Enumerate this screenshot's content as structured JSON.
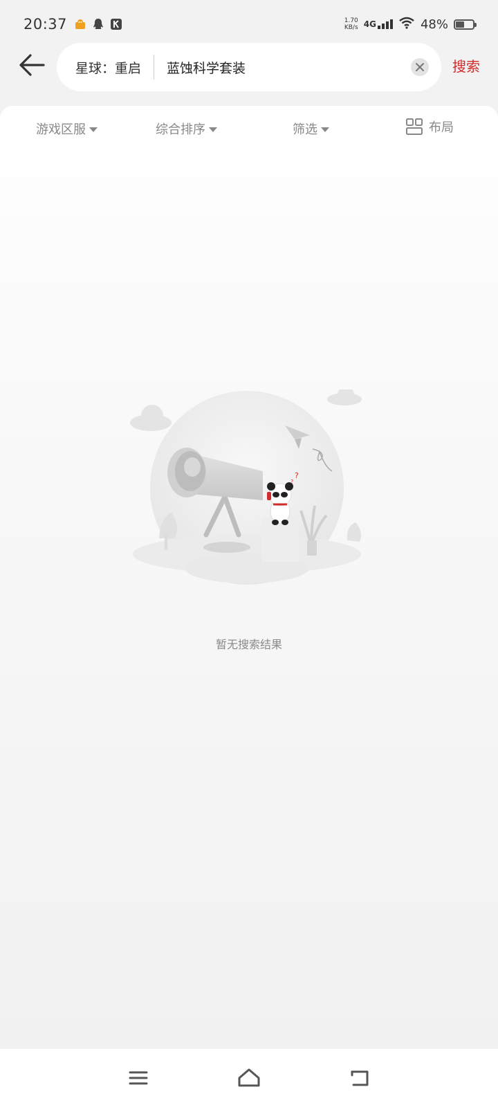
{
  "status_bar": {
    "time": "20:37",
    "net_speed_value": "1.70",
    "net_speed_unit": "KB/s",
    "network_type": "4G",
    "battery_percent": "48%",
    "battery_level": 0.48,
    "notification_icons": [
      "game-notification-icon",
      "qq-icon",
      "k-app-icon"
    ]
  },
  "header": {
    "server_label": "星球：重启",
    "query": "蓝蚀科学套装",
    "search_label": "搜索"
  },
  "filters": {
    "server": "游戏区服",
    "sort": "综合排序",
    "filter": "筛选",
    "layout": "布局"
  },
  "empty_state": {
    "message": "暂无搜索结果"
  },
  "colors": {
    "accent": "#d22b2b",
    "background": "#f2f2f2",
    "muted_text": "#888888"
  }
}
